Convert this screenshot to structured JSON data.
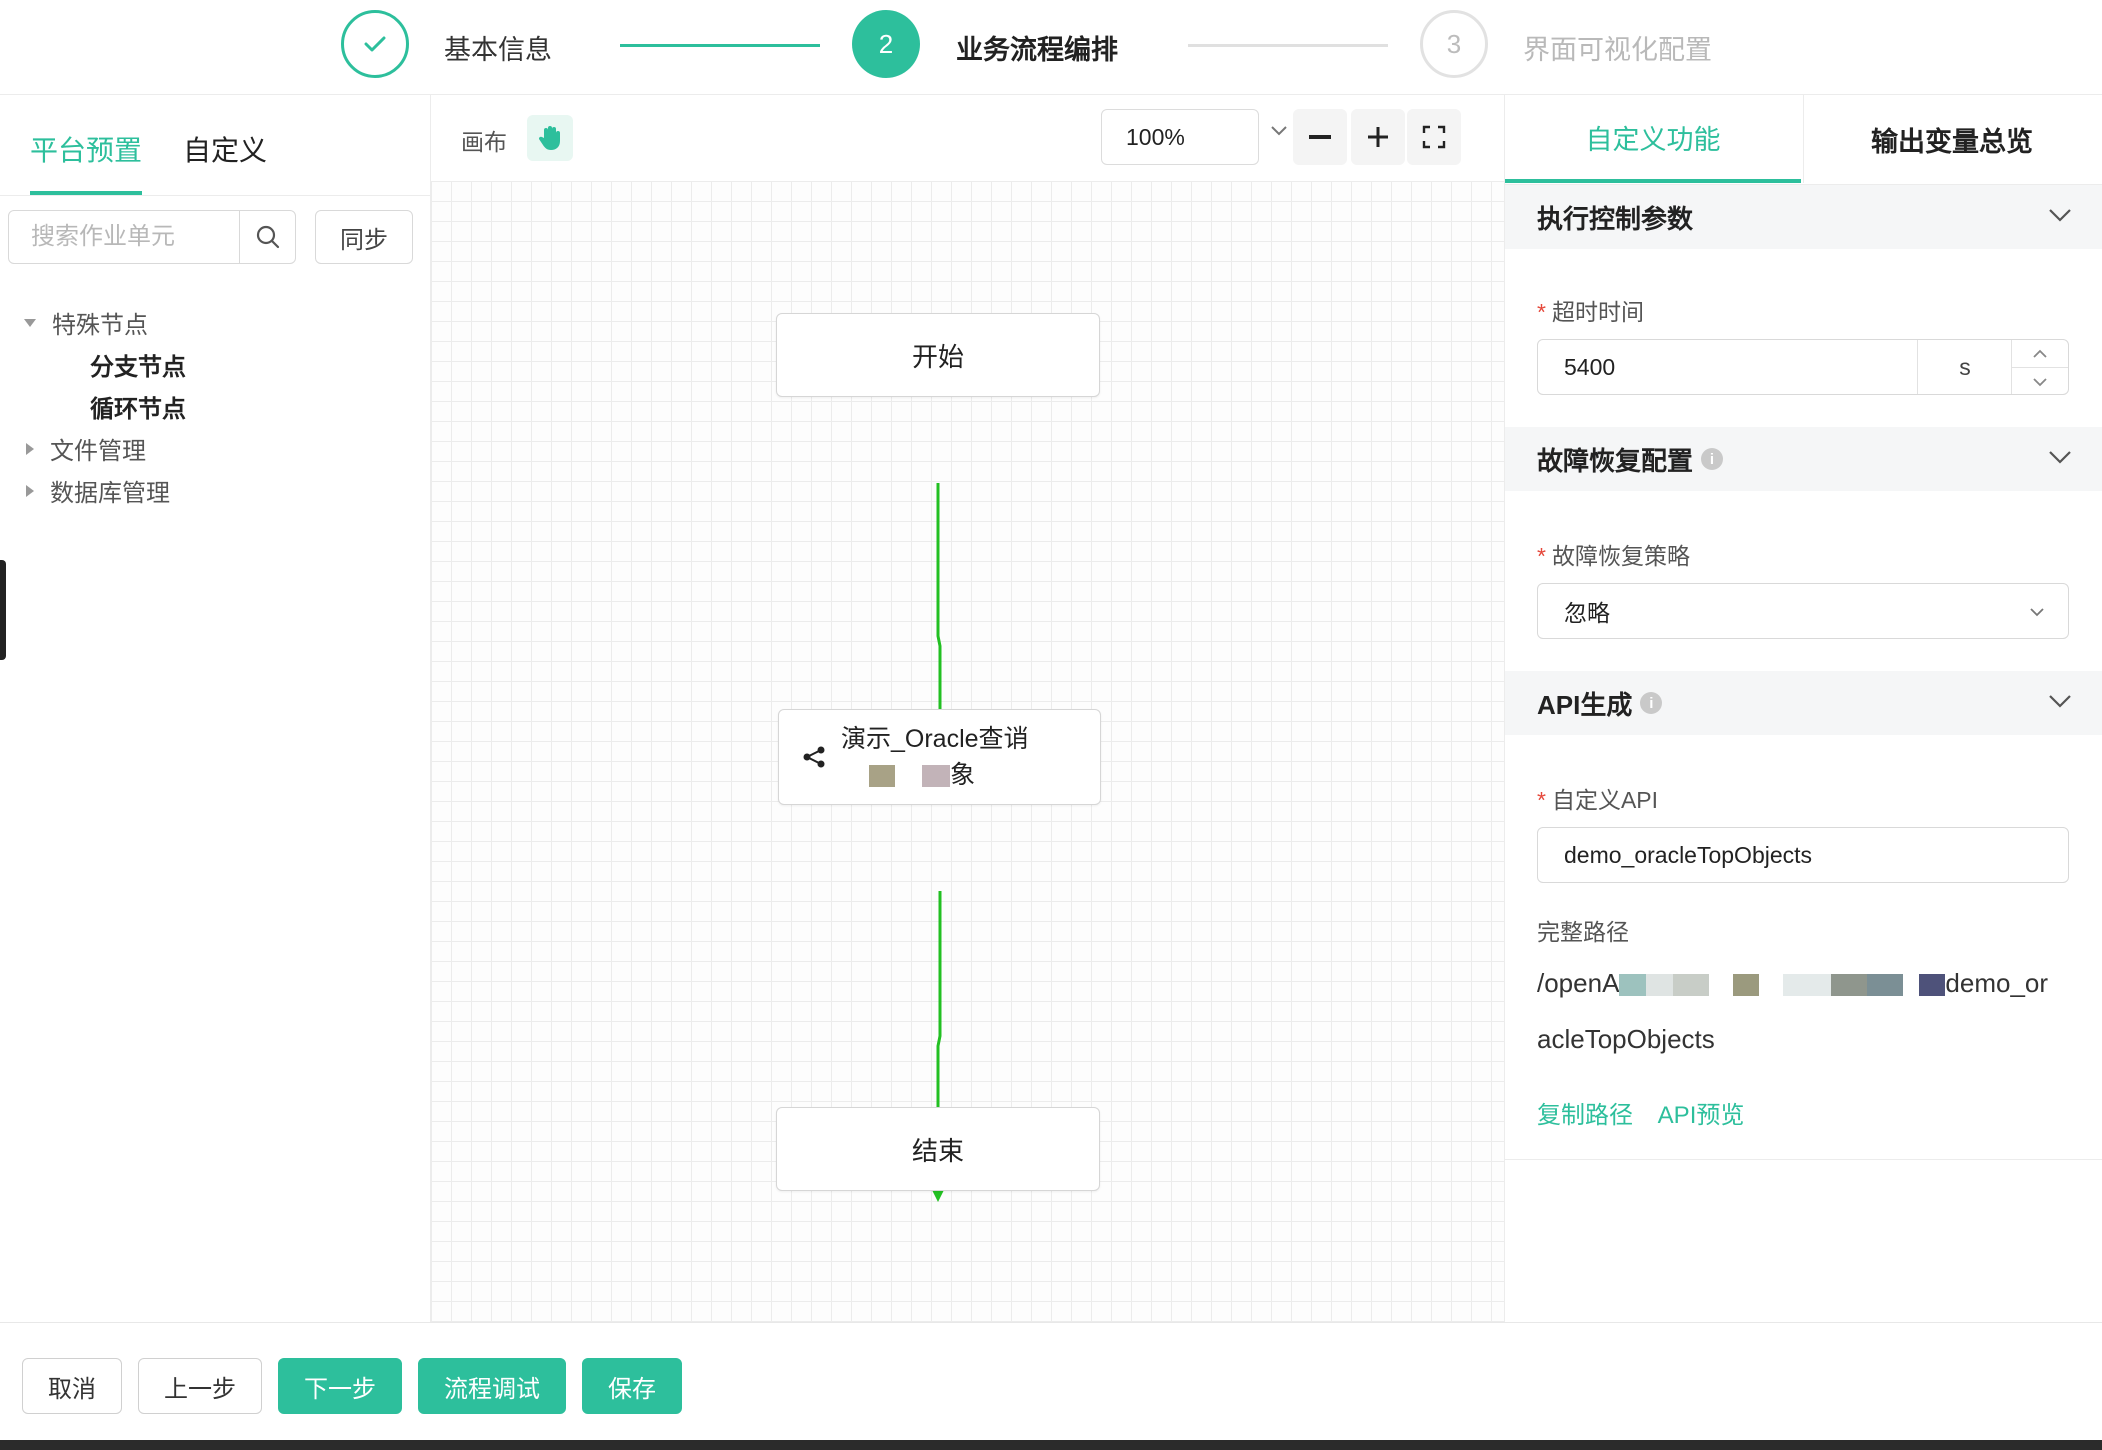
{
  "steps": [
    {
      "index": "✓",
      "label": "基本信息",
      "state": "done"
    },
    {
      "index": "2",
      "label": "业务流程编排",
      "state": "active"
    },
    {
      "index": "3",
      "label": "界面可视化配置",
      "state": "todo"
    }
  ],
  "left_panel": {
    "tabs": [
      "平台预置",
      "自定义"
    ],
    "search": {
      "placeholder": "搜索作业单元"
    },
    "sync_label": "同步",
    "tree": [
      {
        "label": "特殊节点",
        "expanded": true,
        "children": [
          "分支节点",
          "循环节点"
        ]
      },
      {
        "label": "文件管理",
        "expanded": false
      },
      {
        "label": "数据库管理",
        "expanded": false
      }
    ]
  },
  "canvas": {
    "label": "画布",
    "zoom": "100%",
    "nodes": {
      "start": "开始",
      "task_line1": "演示_Oracle查诮",
      "task_line2": "象",
      "end": "结束"
    }
  },
  "right_panel": {
    "tabs": [
      "自定义功能",
      "输出变量总览"
    ],
    "sections": {
      "exec": {
        "title": "执行控制参数",
        "timeout_label": "超时时间",
        "timeout_value": "5400",
        "timeout_unit": "s"
      },
      "recovery": {
        "title": "故障恢复配置",
        "strategy_label": "故障恢复策略",
        "strategy_value": "忽略"
      },
      "api": {
        "title": "API生成",
        "custom_api_label": "自定义API",
        "custom_api_value": "demo_oracleTopObjects",
        "full_path_label": "完整路径",
        "full_path_start": "/openA",
        "full_path_mid": "demo_or",
        "full_path_end": "acleTopObjects",
        "copy_path": "复制路径",
        "api_preview": "API预览"
      }
    }
  },
  "footer": {
    "cancel": "取消",
    "prev": "上一步",
    "next": "下一步",
    "debug": "流程调试",
    "save": "保存"
  },
  "colors": {
    "accent": "#2dbf9c",
    "edge": "#22c022",
    "required": "#e5483b"
  }
}
